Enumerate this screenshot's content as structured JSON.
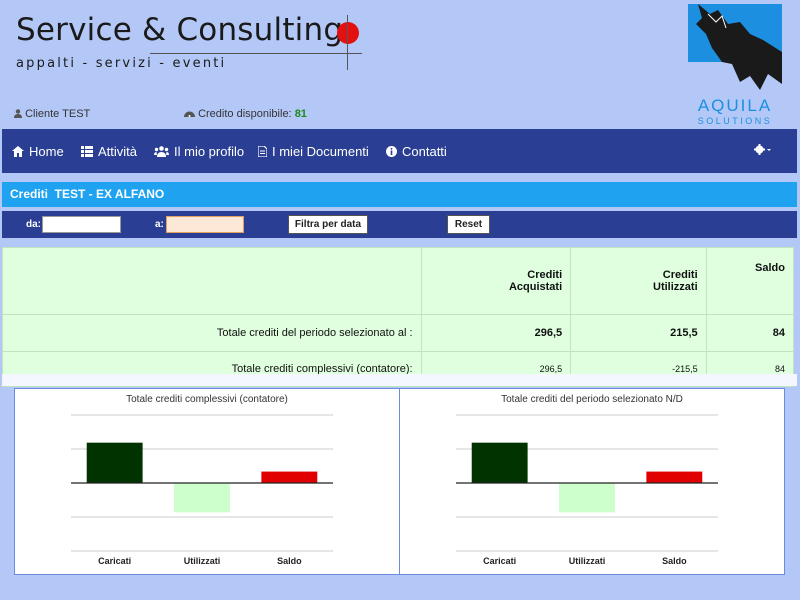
{
  "header": {
    "brand_title": "Service & Consulting",
    "brand_subtitle": "appalti - servizi - eventi",
    "user_label": "Cliente TEST",
    "credit_label": "Credito disponibile:",
    "credit_value": "81",
    "logo_text": "AQUILA",
    "logo_sub": "SOLUTIONS"
  },
  "nav": {
    "items": [
      {
        "label": "Home",
        "icon": "home-icon"
      },
      {
        "label": "Attività",
        "icon": "list-icon"
      },
      {
        "label": "Il mio profilo",
        "icon": "users-icon"
      },
      {
        "label": "I miei Documenti",
        "icon": "document-icon"
      },
      {
        "label": "Contatti",
        "icon": "info-icon"
      }
    ],
    "settings_icon": "gear-icon"
  },
  "page": {
    "title": "Crediti  TEST - EX ALFANO"
  },
  "filter": {
    "from_label": "da:",
    "to_label": "a:",
    "filter_button": "Filtra per data",
    "reset_button": "Reset"
  },
  "table": {
    "headers": [
      "Crediti\nAcquistati",
      "Crediti\nUtilizzati",
      "Saldo"
    ],
    "rows": [
      {
        "label": "Totale crediti del periodo selezionato al :",
        "acquistati": "296,5",
        "utilizzati": "215,5",
        "saldo": "84"
      },
      {
        "label": "Totale crediti complessivi (contatore):",
        "acquistati": "296,5",
        "utilizzati": "-215,5",
        "saldo": "84"
      }
    ]
  },
  "colors": {
    "nav_bg": "#2a3f93",
    "title_bg": "#1fa3f0",
    "caricati": "#003300",
    "utilizzati": "#ccffcc",
    "saldo": "#e00000"
  },
  "chart_data": [
    {
      "type": "bar",
      "title": "Totale crediti complessivi (contatore)",
      "categories": [
        "Caricati",
        "Utilizzati",
        "Saldo"
      ],
      "values": [
        296.5,
        -215.5,
        84
      ],
      "colors": [
        "#003300",
        "#ccffcc",
        "#e00000"
      ],
      "ylim": [
        -500,
        500
      ],
      "grid": true
    },
    {
      "type": "bar",
      "title": "Totale crediti del periodo selezionato N/D",
      "categories": [
        "Caricati",
        "Utilizzati",
        "Saldo"
      ],
      "values": [
        296.5,
        -215.5,
        84
      ],
      "colors": [
        "#003300",
        "#ccffcc",
        "#e00000"
      ],
      "ylim": [
        -500,
        500
      ],
      "grid": true
    }
  ]
}
